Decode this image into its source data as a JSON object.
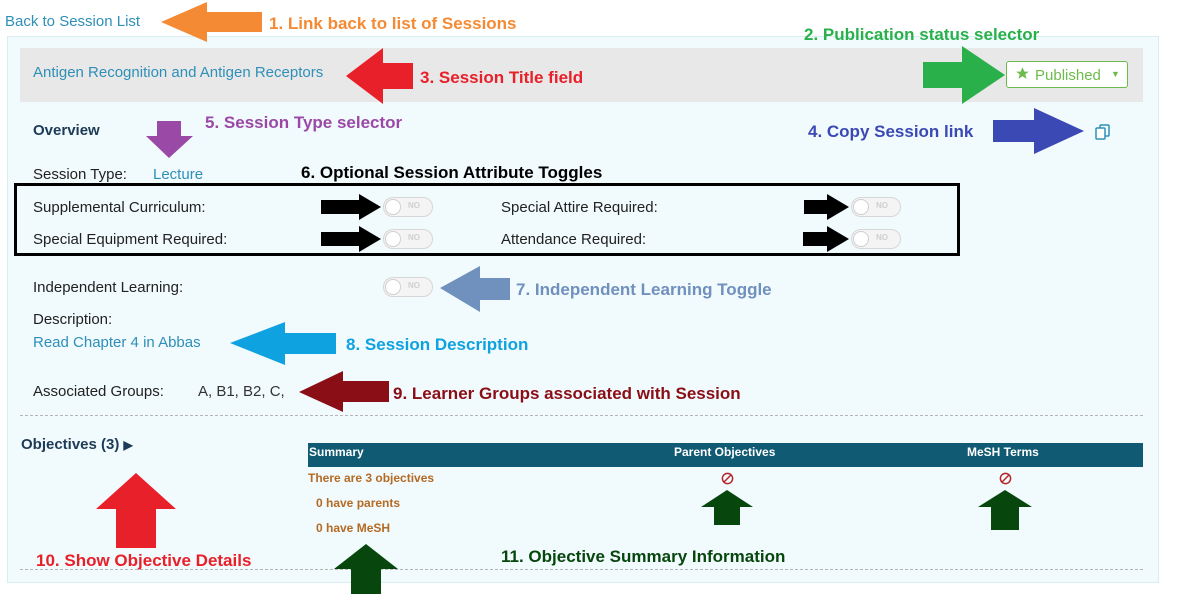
{
  "nav": {
    "back_link": "Back to Session List"
  },
  "session": {
    "title": "Antigen Recognition and Antigen Receptors",
    "publish_status": "Published",
    "overview_heading": "Overview",
    "session_type_label": "Session Type:",
    "session_type_value": "Lecture",
    "toggles": {
      "supplemental": {
        "label": "Supplemental Curriculum:",
        "state": "NO"
      },
      "special_attire": {
        "label": "Special Attire Required:",
        "state": "NO"
      },
      "special_equipment": {
        "label": "Special Equipment Required:",
        "state": "NO"
      },
      "attendance": {
        "label": "Attendance Required:",
        "state": "NO"
      },
      "independent_learning": {
        "label": "Independent Learning:",
        "state": "NO"
      }
    },
    "description_label": "Description:",
    "description_value": "Read Chapter 4 in Abbas",
    "groups_label": "Associated Groups:",
    "groups_value": "A, B1, B2, C,"
  },
  "objectives": {
    "toggle_label": "Objectives (3)",
    "table": {
      "headers": [
        "Summary",
        "Parent Objectives",
        "MeSH Terms"
      ],
      "summary_lines": [
        "There are 3 objectives",
        "0 have parents",
        "0 have MeSH"
      ]
    }
  },
  "annotations": [
    {
      "text": "1. Link back to list of Sessions",
      "color": "#f58a34"
    },
    {
      "text": "2. Publication status selector",
      "color": "#2ab04a"
    },
    {
      "text": "3. Session Title field",
      "color": "#e8202a"
    },
    {
      "text": "4. Copy Session link",
      "color": "#3b49b5"
    },
    {
      "text": "5. Session Type selector",
      "color": "#9a49a6"
    },
    {
      "text": "6. Optional Session Attribute Toggles",
      "color": "#000000"
    },
    {
      "text": "7. Independent Learning Toggle",
      "color": "#7090bd"
    },
    {
      "text": "8. Session Description",
      "color": "#0ea2e0"
    },
    {
      "text": "9. Learner Groups associated with Session",
      "color": "#8a0e16"
    },
    {
      "text": "10. Show Objective Details",
      "color": "#e8202a"
    },
    {
      "text": "11. Objective Summary Information",
      "color": "#07470e"
    }
  ],
  "icons": {
    "star": "star-icon",
    "caret": "caret-down-icon",
    "copy": "copy-icon",
    "expand": "triangle-right-icon",
    "none": "prohibited-icon"
  }
}
